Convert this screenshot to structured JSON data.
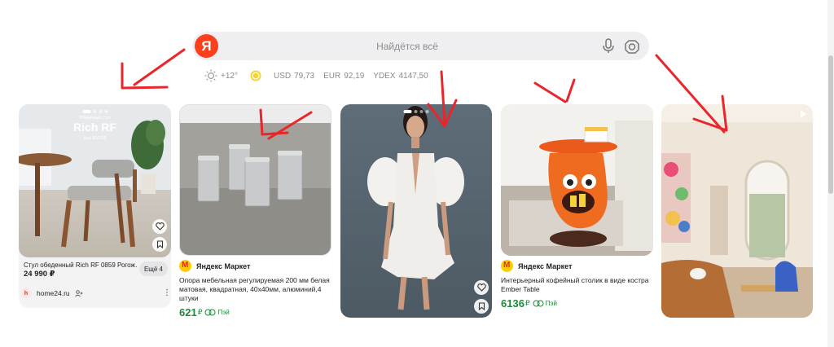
{
  "search": {
    "logo_letter": "Я",
    "placeholder": "Найдётся всё",
    "mic_icon": "microphone-icon",
    "lens_icon": "camera-lens-icon"
  },
  "informers": {
    "weather": "+12°",
    "usd_label": "USD",
    "usd_value": "79,73",
    "eur_label": "EUR",
    "eur_value": "92,19",
    "ydex_label": "YDEX",
    "ydex_value": "4147,50"
  },
  "cards": [
    {
      "overlay_small": "Обеденный стул",
      "overlay_title": "Rich RF",
      "overlay_code": "Код: 910780",
      "title": "Стул обеденный Rich RF 0859 Рогож…",
      "more_label": "Ещё 4",
      "price": "24 990 ₽",
      "shop": "home24.ru"
    },
    {
      "shop": "Яндекс Маркет",
      "description": "Опора мебельная регулируемая 200 мм белая матовая, квадратная, 40x40мм, алюминий,4 штуки",
      "price": "621",
      "currency": "₽",
      "pay_label": "Пэй"
    },
    {
      "kind": "photo-dress"
    },
    {
      "shop": "Яндекс Маркет",
      "description": "Интерьерный кофейный столик в виде костра Ember Table",
      "price": "6136",
      "currency": "₽",
      "pay_label": "Пэй"
    },
    {
      "kind": "photo-interior"
    }
  ],
  "colors": {
    "brand_red": "#fc3f1d",
    "price_green": "#1f8a3c",
    "arrow_red": "#e8262b"
  }
}
